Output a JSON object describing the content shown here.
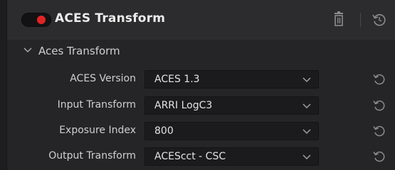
{
  "node": {
    "title": "ACES Transform",
    "enabled_color": "#e02424",
    "icons": {
      "delete": "trash-icon",
      "reset": "reset-icon"
    }
  },
  "section": {
    "title": "Aces Transform",
    "expanded": true
  },
  "rows": [
    {
      "label": "ACES Version",
      "value": "ACES 1.3"
    },
    {
      "label": "Input Transform",
      "value": "ARRI LogC3"
    },
    {
      "label": "Exposure Index",
      "value": "800"
    },
    {
      "label": "Output Transform",
      "value": "ACEScct - CSC"
    }
  ]
}
